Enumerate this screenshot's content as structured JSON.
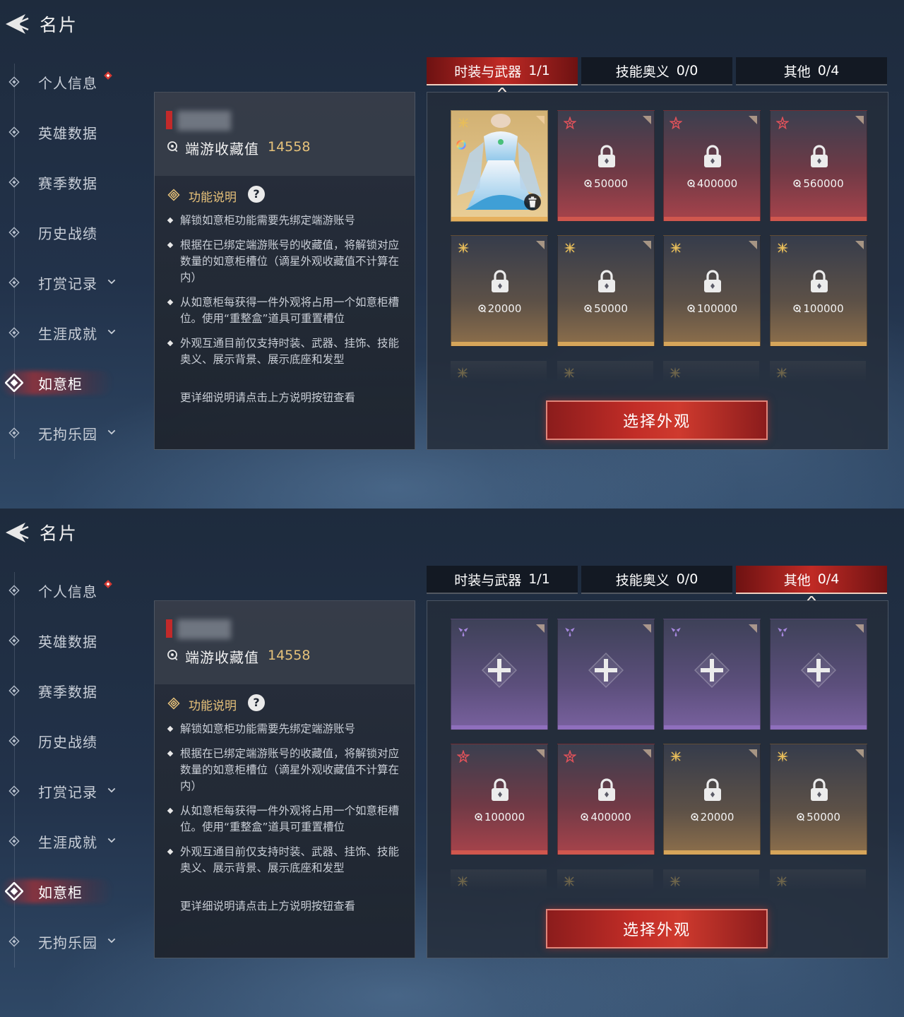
{
  "colors": {
    "accent_red": "#c22d27",
    "gold_text": "#e6c27a",
    "purple_card": "#8f6fbd",
    "gold_card": "#d6a55a",
    "red_card": "#d0574e"
  },
  "screens": [
    {
      "header": {
        "title": "名片",
        "back_icon": "back-arrow-icon"
      },
      "nav": [
        {
          "label": "个人信息",
          "badge": true,
          "expand": false,
          "active": false
        },
        {
          "label": "英雄数据",
          "badge": false,
          "expand": false,
          "active": false
        },
        {
          "label": "赛季数据",
          "badge": false,
          "expand": false,
          "active": false
        },
        {
          "label": "历史战绩",
          "badge": false,
          "expand": false,
          "active": false
        },
        {
          "label": "打赏记录",
          "badge": false,
          "expand": true,
          "active": false
        },
        {
          "label": "生涯成就",
          "badge": false,
          "expand": true,
          "active": false
        },
        {
          "label": "如意柜",
          "badge": false,
          "expand": false,
          "active": true
        },
        {
          "label": "无拘乐园",
          "badge": false,
          "expand": true,
          "active": false
        }
      ],
      "info": {
        "collection_label": "端游收藏值",
        "collection_value": "14558",
        "func_title": "功能说明",
        "help": "?",
        "bullets": [
          "解锁如意柜功能需要先绑定端游账号",
          "根据在已绑定端游账号的收藏值，将解锁对应数量的如意柜槽位（谪星外观收藏值不计算在内）",
          "从如意柜每获得一件外观将占用一个如意柜槽位。使用“重整盒”道具可重置槽位",
          "外观互通目前仅支持时装、武器、挂饰、技能奥义、展示背景、展示底座和发型"
        ],
        "more_note": "更详细说明请点击上方说明按钮查看"
      },
      "tabs": [
        {
          "name": "时装与武器",
          "count": "1/1",
          "active": true
        },
        {
          "name": "技能奥义",
          "count": "0/0",
          "active": false
        },
        {
          "name": "其他",
          "count": "0/4",
          "active": false
        }
      ],
      "cards": [
        {
          "kind": "skin",
          "rarity": "gold"
        },
        {
          "kind": "locked",
          "rarity": "red",
          "cost": "50000"
        },
        {
          "kind": "locked",
          "rarity": "red",
          "cost": "400000"
        },
        {
          "kind": "locked",
          "rarity": "red",
          "cost": "560000"
        },
        {
          "kind": "locked",
          "rarity": "gold",
          "cost": "20000"
        },
        {
          "kind": "locked",
          "rarity": "gold",
          "cost": "50000"
        },
        {
          "kind": "locked",
          "rarity": "gold",
          "cost": "100000"
        },
        {
          "kind": "locked",
          "rarity": "gold",
          "cost": "100000"
        }
      ],
      "select_button": "选择外观"
    },
    {
      "header": {
        "title": "名片",
        "back_icon": "back-arrow-icon"
      },
      "nav": [
        {
          "label": "个人信息",
          "badge": true,
          "expand": false,
          "active": false
        },
        {
          "label": "英雄数据",
          "badge": false,
          "expand": false,
          "active": false
        },
        {
          "label": "赛季数据",
          "badge": false,
          "expand": false,
          "active": false
        },
        {
          "label": "历史战绩",
          "badge": false,
          "expand": false,
          "active": false
        },
        {
          "label": "打赏记录",
          "badge": false,
          "expand": true,
          "active": false
        },
        {
          "label": "生涯成就",
          "badge": false,
          "expand": true,
          "active": false
        },
        {
          "label": "如意柜",
          "badge": false,
          "expand": false,
          "active": true
        },
        {
          "label": "无拘乐园",
          "badge": false,
          "expand": true,
          "active": false
        }
      ],
      "info": {
        "collection_label": "端游收藏值",
        "collection_value": "14558",
        "func_title": "功能说明",
        "help": "?",
        "bullets": [
          "解锁如意柜功能需要先绑定端游账号",
          "根据在已绑定端游账号的收藏值，将解锁对应数量的如意柜槽位（谪星外观收藏值不计算在内）",
          "从如意柜每获得一件外观将占用一个如意柜槽位。使用“重整盒”道具可重置槽位",
          "外观互通目前仅支持时装、武器、挂饰、技能奥义、展示背景、展示底座和发型"
        ],
        "more_note": "更详细说明请点击上方说明按钮查看"
      },
      "tabs": [
        {
          "name": "时装与武器",
          "count": "1/1",
          "active": false
        },
        {
          "name": "技能奥义",
          "count": "0/0",
          "active": false
        },
        {
          "name": "其他",
          "count": "0/4",
          "active": true
        }
      ],
      "cards": [
        {
          "kind": "add",
          "rarity": "purple"
        },
        {
          "kind": "add",
          "rarity": "purple"
        },
        {
          "kind": "add",
          "rarity": "purple"
        },
        {
          "kind": "add",
          "rarity": "purple"
        },
        {
          "kind": "locked",
          "rarity": "red",
          "cost": "100000"
        },
        {
          "kind": "locked",
          "rarity": "red",
          "cost": "400000"
        },
        {
          "kind": "locked",
          "rarity": "gold",
          "cost": "20000"
        },
        {
          "kind": "locked",
          "rarity": "gold",
          "cost": "50000"
        }
      ],
      "select_button": "选择外观"
    }
  ]
}
